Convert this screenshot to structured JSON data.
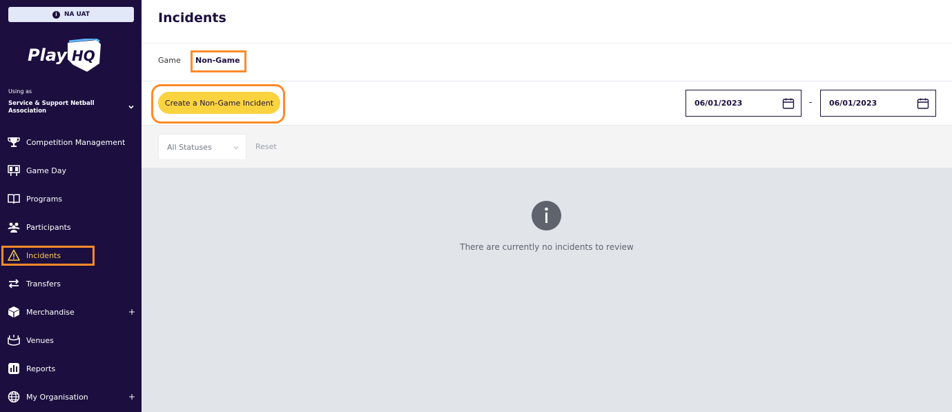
{
  "env": {
    "badge_label": "NA UAT",
    "badge_icon": "i"
  },
  "brand": {
    "logo_text_a": "Play",
    "logo_text_b": "HQ"
  },
  "account": {
    "using_as_label": "Using as",
    "org_name": "Service & Support Netball Association"
  },
  "nav": {
    "items": [
      {
        "label": "Competition Management",
        "icon": "trophy-icon"
      },
      {
        "label": "Game Day",
        "icon": "scoreboard-icon"
      },
      {
        "label": "Programs",
        "icon": "book-icon"
      },
      {
        "label": "Participants",
        "icon": "people-icon"
      },
      {
        "label": "Incidents",
        "icon": "warning-icon",
        "active": true
      },
      {
        "label": "Transfers",
        "icon": "transfer-arrows-icon"
      },
      {
        "label": "Merchandise",
        "icon": "box-icon",
        "expand": "+"
      },
      {
        "label": "Venues",
        "icon": "stadium-icon"
      },
      {
        "label": "Reports",
        "icon": "bar-chart-icon"
      },
      {
        "label": "My Organisation",
        "icon": "globe-icon",
        "expand": "+"
      }
    ]
  },
  "page": {
    "title": "Incidents"
  },
  "tabs": {
    "game": "Game",
    "non_game": "Non-Game"
  },
  "toolbar": {
    "create_label": "Create a Non-Game Incident",
    "date_from": "06/01/2023",
    "date_separator": "-",
    "date_to": "06/01/2023"
  },
  "filters": {
    "status_value": "All Statuses",
    "reset_label": "Reset"
  },
  "empty_state": {
    "icon_glyph": "i",
    "message": "There are currently no incidents to review"
  },
  "colors": {
    "sidebar_bg": "#1c0f3f",
    "accent_yellow": "#fbd33f",
    "highlight_orange": "#ff8a2a",
    "active_text": "#f9c84a"
  }
}
